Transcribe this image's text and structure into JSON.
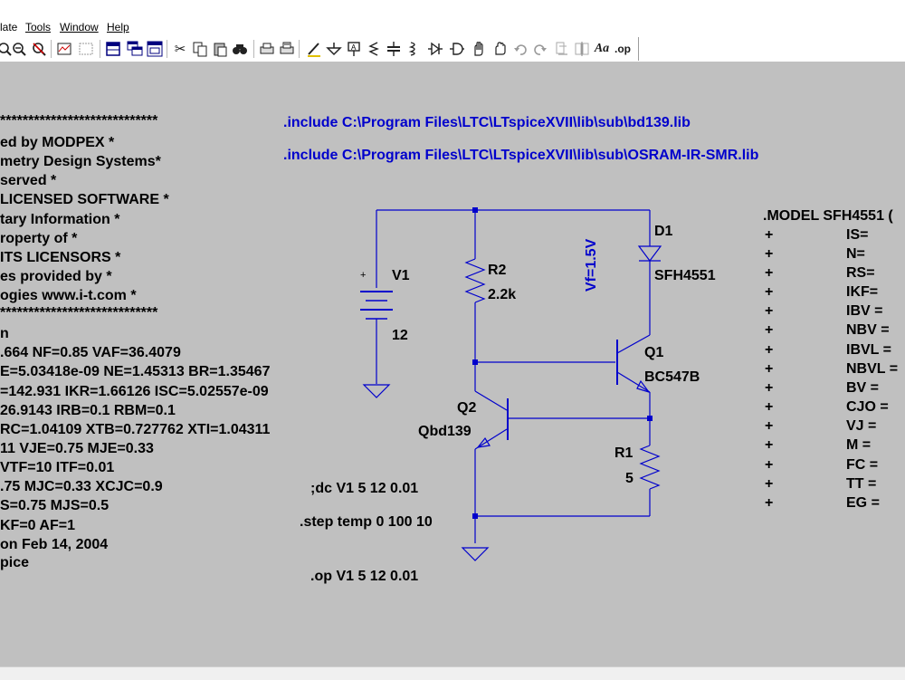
{
  "menu": [
    "late",
    "Tools",
    "Window",
    "Help"
  ],
  "toolbar_icons": [
    "zoom-in-icon",
    "zoom-out-icon",
    "zoom-cancel-icon",
    "zoom-fit-icon",
    "zoom-area-icon",
    "tile-icon",
    "cascade-icon",
    "window-icon",
    "cut-icon",
    "copy-icon",
    "paste-icon",
    "find-icon",
    "print-setup-icon",
    "print-icon",
    "draw-wire-icon",
    "ground-icon",
    "label-icon",
    "resistor-icon",
    "capacitor-icon",
    "inductor-icon",
    "diode-icon",
    "component-icon",
    "move-icon",
    "drag-icon",
    "undo-icon",
    "redo-icon",
    "rotate-icon",
    "mirror-icon",
    "text-icon",
    "spice-directive-icon"
  ],
  "toolbar_text_glyphs": {
    "text": "Aa",
    "spice_directive": ".op"
  },
  "model_text": [
    "****************************",
    "ed by MODPEX     *",
    "metry Design Systems*",
    "served         *",
    "LICENSED SOFTWARE   *",
    "tary Information *",
    "roperty of      *",
    "ITS LICENSORS     *",
    "es provided by   *",
    "ogies www.i-t.com *",
    "****************************",
    "n",
    ".664 NF=0.85 VAF=36.4079",
    "E=5.03418e-09 NE=1.45313 BR=1.35467",
    "=142.931 IKR=1.66126 ISC=5.02557e-09",
    "26.9143 IRB=0.1 RBM=0.1",
    "RC=1.04109 XTB=0.727762 XTI=1.04311",
    "11 VJE=0.75 MJE=0.33",
    "VTF=10 ITF=0.01",
    ".75 MJC=0.33 XCJC=0.9",
    "S=0.75 MJS=0.5",
    "KF=0 AF=1",
    "on Feb 14, 2004",
    "pice"
  ],
  "directives": {
    "include1": ".include C:\\Program Files\\LTC\\LTspiceXVII\\lib\\sub\\bd139.lib",
    "include2": ".include C:\\Program Files\\LTC\\LTspiceXVII\\lib\\sub\\OSRAM-IR-SMR.lib",
    "dc": ";dc V1 5 12 0.01",
    "step": ".step temp 0 100 10",
    "op": ".op V1 5 12 0.01"
  },
  "components": {
    "v1": {
      "name": "V1",
      "value": "12",
      "plus": "+"
    },
    "r2": {
      "name": "R2",
      "value": "2.2k"
    },
    "r1": {
      "name": "R1",
      "value": "5"
    },
    "d1": {
      "name": "D1",
      "value": "SFH4551",
      "attr": "Vf=1.5V"
    },
    "q1": {
      "name": "Q1",
      "value": "BC547B"
    },
    "q2": {
      "name": "Q2",
      "value": "Qbd139"
    }
  },
  "model_right": {
    "header": ".MODEL SFH4551 (",
    "plus": "+",
    "params": [
      "IS=",
      "N=",
      "RS=",
      "IKF=",
      "IBV =",
      "NBV =",
      "IBVL =",
      "NBVL =",
      "BV =",
      "CJO =",
      "VJ =",
      "M =",
      "FC =",
      "TT =",
      "EG ="
    ]
  },
  "colors": {
    "canvas": "#c0c0c0",
    "wire": "#0000cc",
    "directive": "#0000cc",
    "text": "#000000"
  }
}
